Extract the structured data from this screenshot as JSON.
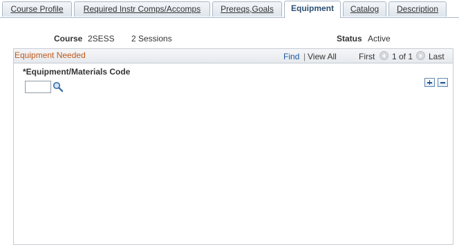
{
  "tabs": [
    {
      "label": "Course Profile"
    },
    {
      "label": "Required Instr Comps/Accomps"
    },
    {
      "label": "Prereqs,Goals"
    },
    {
      "label": "Equipment"
    },
    {
      "label": "Catalog"
    },
    {
      "label": "Description"
    }
  ],
  "active_tab": "Equipment",
  "header": {
    "course_label": "Course",
    "course_code": "2SESS",
    "course_desc": "2 Sessions",
    "status_label": "Status",
    "status_value": "Active"
  },
  "grid": {
    "title": "Equipment Needed",
    "find": "Find",
    "separator": "|",
    "view_all": "View All",
    "first": "First",
    "page_info": "1 of 1",
    "last": "Last",
    "field_label": "*Equipment/Materials Code",
    "field_value": ""
  },
  "colors": {
    "title": "#c05a1b",
    "link": "#1a57a3",
    "border": "#a9b7c8"
  },
  "icons": {
    "lookup": "magnifier-icon",
    "prev": "previous-arrow-icon",
    "next": "next-arrow-icon",
    "add": "plus-icon",
    "delete": "minus-icon"
  }
}
